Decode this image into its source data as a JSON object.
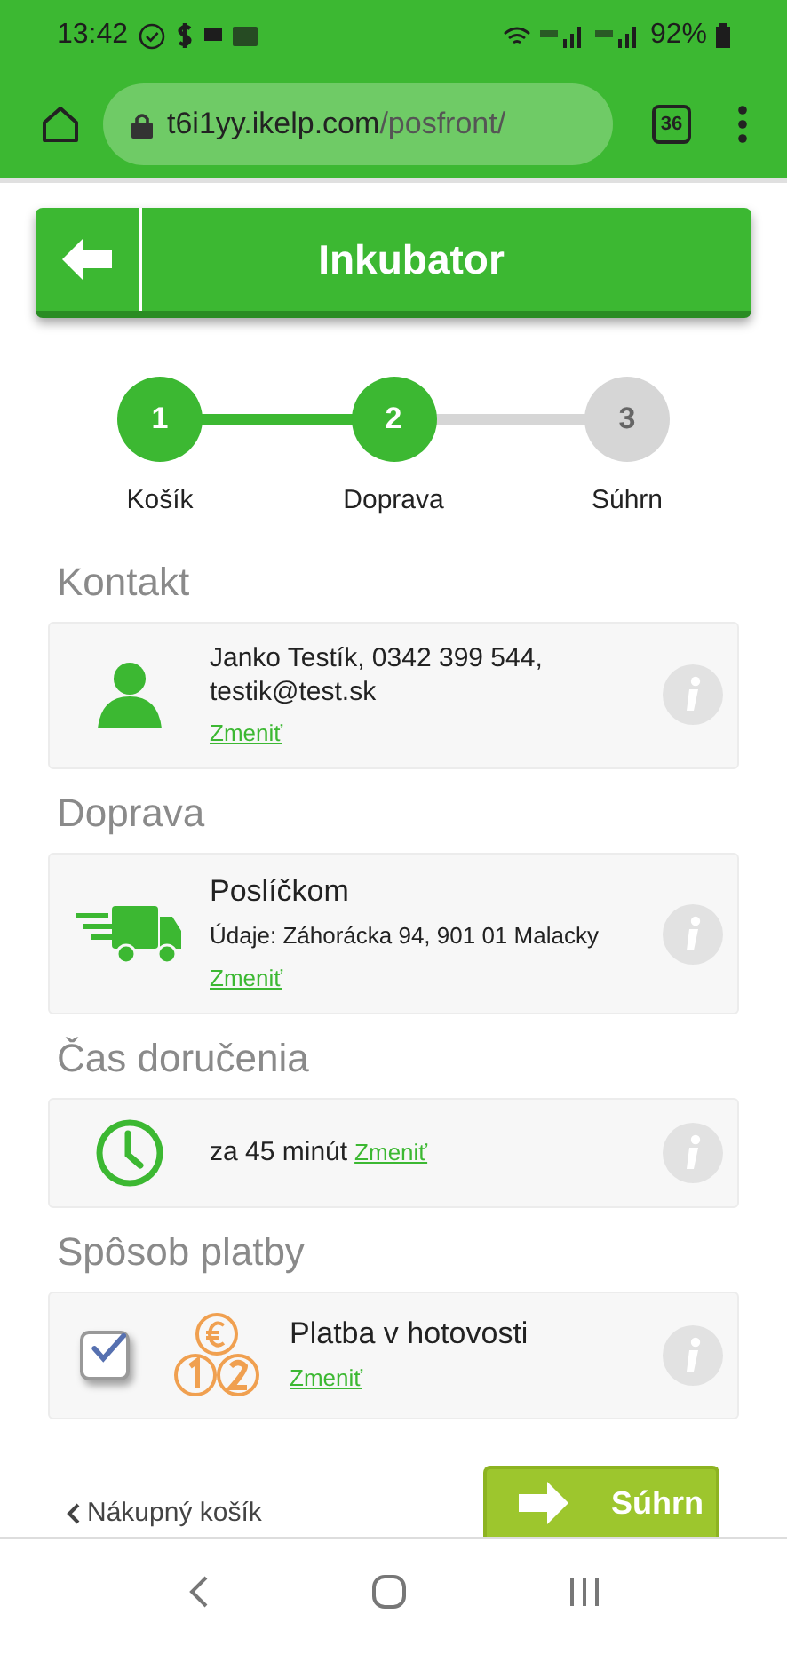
{
  "status_bar": {
    "time": "13:42",
    "battery": "92%"
  },
  "browser": {
    "url_host": "t6i1yy.ikelp.com",
    "url_path": "/posfront/",
    "tab_count": "36"
  },
  "header": {
    "title": "Inkubator"
  },
  "steps": [
    {
      "number": "1",
      "label": "Košík",
      "completed": true
    },
    {
      "number": "2",
      "label": "Doprava",
      "completed": true
    },
    {
      "number": "3",
      "label": "Súhrn",
      "completed": false
    }
  ],
  "sections": [
    {
      "kind": "contact",
      "heading": "Kontakt",
      "text": "Janko Testík, 0342 399 544, testik@test.sk",
      "link": "Zmeniť"
    },
    {
      "kind": "delivery",
      "heading": "Doprava",
      "title": "Poslíčkom",
      "detail": "Údaje: Záhorácka 94, 901 01 Malacky",
      "link": "Zmeniť"
    },
    {
      "kind": "time",
      "heading": "Čas doručenia",
      "text": "za 45 minút",
      "link": "Zmeniť"
    },
    {
      "kind": "payment",
      "heading": "Spôsob platby",
      "title": "Platba v hotovosti",
      "link": "Zmeniť",
      "checked": true
    }
  ],
  "footer": {
    "back_link": "Nákupný košík",
    "next_button": "Súhrn"
  }
}
